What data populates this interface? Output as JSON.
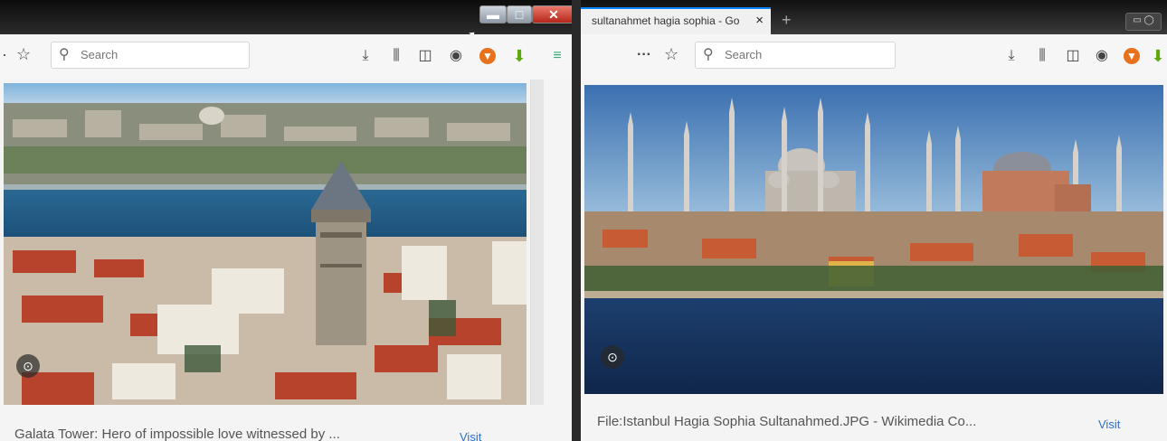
{
  "left_window": {
    "toolbar": {
      "search_placeholder": "Search"
    },
    "result": {
      "caption": "Galata Tower: Hero of impossible love witnessed by ...",
      "visit_label": "Visit"
    }
  },
  "right_window": {
    "tab": {
      "title": "sultanahmet hagia sophia - Go",
      "close_glyph": "×"
    },
    "toolbar": {
      "overflow_label": "···",
      "search_placeholder": "Search"
    },
    "result": {
      "caption": "File:Istanbul Hagia Sophia Sultanahmed.JPG - Wikimedia Co...",
      "visit_label": "Visit"
    }
  },
  "icons": [
    "bookmark-star-icon",
    "search-icon",
    "download-icon",
    "library-icon",
    "sidebar-icon",
    "account-icon",
    "extension-orange-icon",
    "extension-green-icon",
    "lens-icon",
    "close-icon",
    "menu-icon"
  ],
  "colors": {
    "tab_accent": "#0a84ff",
    "close_button": "#c62f20",
    "link": "#2b6fd6"
  }
}
